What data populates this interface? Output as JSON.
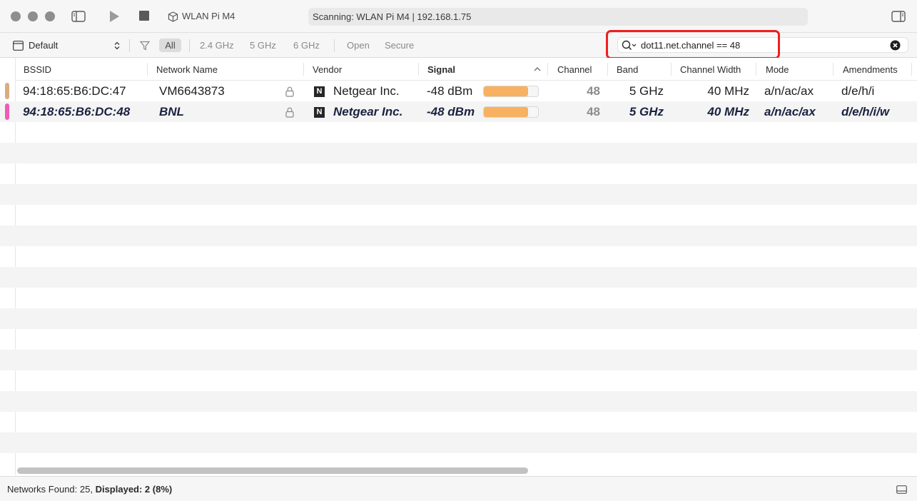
{
  "window": {
    "device_name": "WLAN Pi M4",
    "status": "Scanning: WLAN Pi M4 | 192.168.1.75",
    "icons": [
      "sidebar-toggle-icon",
      "play-icon",
      "stop-icon",
      "cube-icon",
      "inspector-toggle-icon"
    ]
  },
  "filterbar": {
    "preset": "Default",
    "bands": [
      "All",
      "2.4 GHz",
      "5 GHz",
      "6 GHz"
    ],
    "security": [
      "Open",
      "Secure"
    ],
    "search_value": "dot11.net.channel == 48",
    "highlight_color": "#ef1f1f"
  },
  "table": {
    "columns": [
      "BSSID",
      "Network Name",
      "Vendor",
      "Signal",
      "Channel",
      "Band",
      "Channel Width",
      "Mode",
      "Amendments"
    ],
    "sorted_column": "Signal",
    "rows": [
      {
        "bssid": "94:18:65:B6:DC:47",
        "network_name": "VM6643873",
        "secured": true,
        "vendor_logo": "N",
        "vendor": "Netgear Inc.",
        "signal": "-48 dBm",
        "signal_level": 0.82,
        "channel": "48",
        "band": "5 GHz",
        "channel_width": "40 MHz",
        "mode": "a/n/ac/ax",
        "amendments": "d/e/h/i",
        "marker_color": "#d9ad80",
        "selected": false
      },
      {
        "bssid": "94:18:65:B6:DC:48",
        "network_name": "BNL",
        "secured": true,
        "vendor_logo": "N",
        "vendor": "Netgear Inc.",
        "signal": "-48 dBm",
        "signal_level": 0.82,
        "channel": "48",
        "band": "5 GHz",
        "channel_width": "40 MHz",
        "mode": "a/n/ac/ax",
        "amendments": "d/e/h/i/w",
        "marker_color": "#ee5cb4",
        "selected": true
      }
    ],
    "signal_color": "#f8b160"
  },
  "footer": {
    "found_label": "Networks Found: 25,",
    "displayed_label": "Displayed: 2 (8%)"
  }
}
